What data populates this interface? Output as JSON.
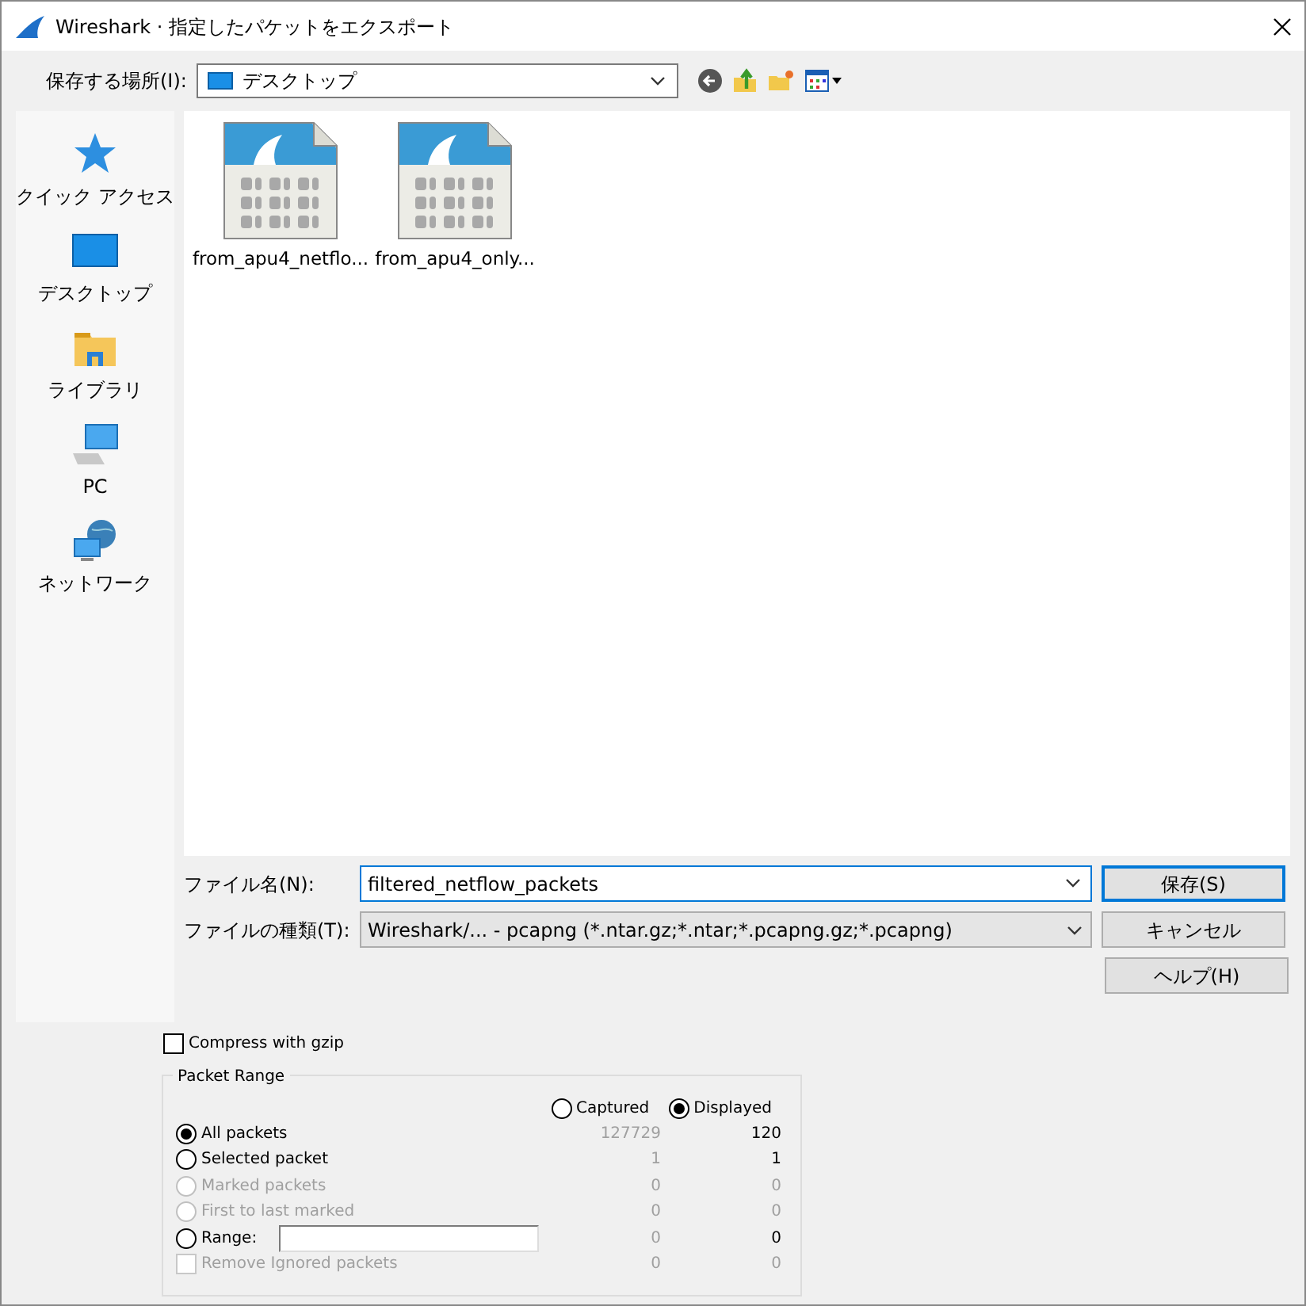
{
  "window": {
    "title": "Wireshark · 指定したパケットをエクスポート"
  },
  "location": {
    "label": "保存する場所(I):",
    "value": "デスクトップ"
  },
  "sidebar": {
    "items": [
      {
        "label": "クイック アクセス",
        "kind": "star",
        "selected": false
      },
      {
        "label": "デスクトップ",
        "kind": "desktop",
        "selected": false
      },
      {
        "label": "ライブラリ",
        "kind": "library",
        "selected": false
      },
      {
        "label": "PC",
        "kind": "pc",
        "selected": false
      },
      {
        "label": "ネットワーク",
        "kind": "network",
        "selected": false
      }
    ]
  },
  "files": [
    {
      "name": "from_apu4_netflo..."
    },
    {
      "name": "from_apu4_only..."
    }
  ],
  "file_name": {
    "label": "ファイル名(N):",
    "value": "filtered_netflow_packets"
  },
  "file_type": {
    "label": "ファイルの種類(T):",
    "value": "Wireshark/... - pcapng (*.ntar.gz;*.ntar;*.pcapng.gz;*.pcapng)"
  },
  "buttons": [
    {
      "label": "保存(S)",
      "default": true
    },
    {
      "label": "キャンセル",
      "default": false
    },
    {
      "label": "ヘルプ(H)",
      "default": false
    }
  ],
  "compress": {
    "label": "Compress with gzip",
    "checked": false
  },
  "packet_range": {
    "title": "Packet Range",
    "columns": [
      {
        "label": "Captured",
        "selected": false
      },
      {
        "label": "Displayed",
        "selected": true
      }
    ],
    "rows": [
      {
        "kind": "radio",
        "label": "All packets",
        "selected": true,
        "disabled": false,
        "captured": "127729",
        "displayed": "120"
      },
      {
        "kind": "radio",
        "label": "Selected packet",
        "selected": false,
        "disabled": false,
        "captured": "1",
        "displayed": "1"
      },
      {
        "kind": "radio",
        "label": "Marked packets",
        "selected": false,
        "disabled": true,
        "captured": "0",
        "displayed": "0"
      },
      {
        "kind": "radio",
        "label": "First to last marked",
        "selected": false,
        "disabled": true,
        "captured": "0",
        "displayed": "0"
      },
      {
        "kind": "range",
        "label": "Range:",
        "selected": false,
        "disabled": false,
        "captured": "0",
        "displayed": "0"
      },
      {
        "kind": "checkbox",
        "label": "Remove Ignored packets",
        "checked": false,
        "disabled": true,
        "captured": "0",
        "displayed": "0"
      }
    ]
  }
}
